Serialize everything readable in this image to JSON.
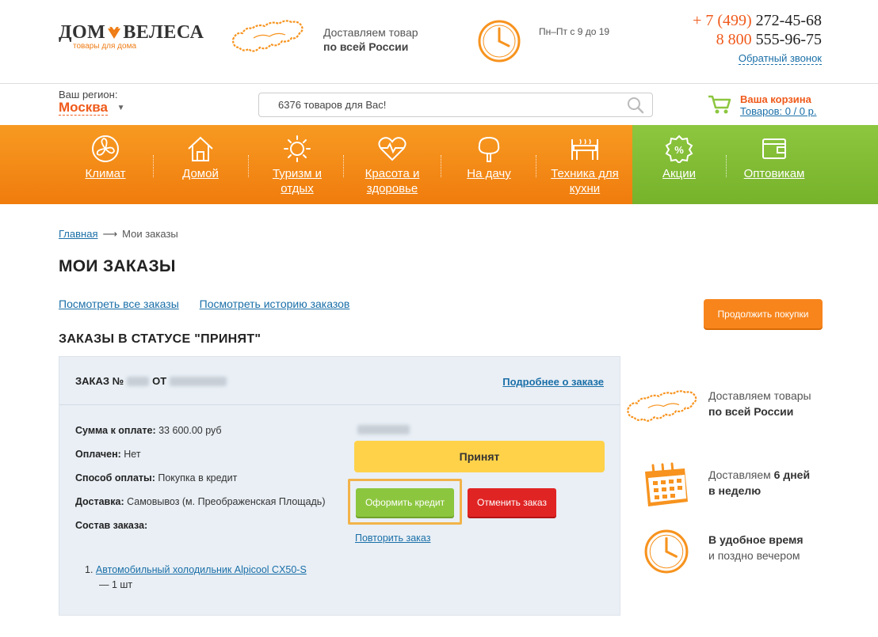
{
  "header": {
    "logo_main_left": "ДОМ",
    "logo_main_right": "ВЕЛЕСА",
    "logo_sub": "товары для дома",
    "delivery_line1": "Доставляем товар",
    "delivery_line2": "по всей России",
    "hours": "Пн–Пт с 9 до 19",
    "phone1_code": "+ 7 (499)",
    "phone1_number": "272-45-68",
    "phone2_code": "8 800",
    "phone2_number": "555-96-75",
    "callback": "Обратный звонок"
  },
  "subheader": {
    "region_label": "Ваш регион:",
    "region_city": "Москва",
    "search_placeholder": "6376 товаров для Вас!",
    "cart_title": "Ваша корзина",
    "cart_summary": "Товаров: 0 / 0 р."
  },
  "nav": {
    "items": [
      {
        "label": "Климат",
        "icon": "fan-icon"
      },
      {
        "label": "Домой",
        "icon": "house-icon"
      },
      {
        "label": "Туризм и отдых",
        "icon": "sun-icon"
      },
      {
        "label": "Красота и здоровье",
        "icon": "heart-pulse-icon"
      },
      {
        "label": "На дачу",
        "icon": "tree-icon"
      },
      {
        "label": "Техника для кухни",
        "icon": "kitchen-icon"
      }
    ],
    "green_items": [
      {
        "label": "Акции",
        "icon": "percent-icon"
      },
      {
        "label": "Оптовикам",
        "icon": "wallet-icon"
      }
    ],
    "colors": {
      "orange": "#f58a1f",
      "green": "#82bc35"
    }
  },
  "breadcrumb": {
    "home": "Главная",
    "current": "Мои заказы"
  },
  "page_title": "МОИ ЗАКАЗЫ",
  "links": {
    "all_orders": "Посмотреть все заказы",
    "history": "Посмотреть историю заказов"
  },
  "continue_button": "Продолжить покупки",
  "section_title": "ЗАКАЗЫ В СТАТУСЕ \"ПРИНЯТ\"",
  "order": {
    "number_prefix": "ЗАКАЗ №",
    "from_label": "ОТ",
    "details_link": "Подробнее о заказе",
    "sum_label": "Сумма к оплате:",
    "sum_value": "33 600.00 руб",
    "paid_label": "Оплачен:",
    "paid_value": "Нет",
    "payment_label": "Способ оплаты:",
    "payment_value": "Покупка в кредит",
    "delivery_label": "Доставка:",
    "delivery_value": "Самовывоз (м. Преображенская Площадь)",
    "composition_label": "Состав заказа:",
    "item_name": "Автомобильный холодильник Alpicool CX50-S",
    "item_qty": "— 1 шт",
    "status": "Принят",
    "credit_button": "Оформить кредит",
    "cancel_button": "Отменить заказ",
    "repeat_link": "Повторить заказ"
  },
  "features": [
    {
      "line1": "Доставляем товары",
      "line2": "по всей России",
      "icon": "russia-map-icon"
    },
    {
      "line1_a": "Доставляем ",
      "line1_b": "6 дней",
      "line2": "в неделю",
      "icon": "calendar-icon"
    },
    {
      "line1": "В удобное время",
      "line2": "и поздно вечером",
      "icon": "clock-icon"
    }
  ]
}
